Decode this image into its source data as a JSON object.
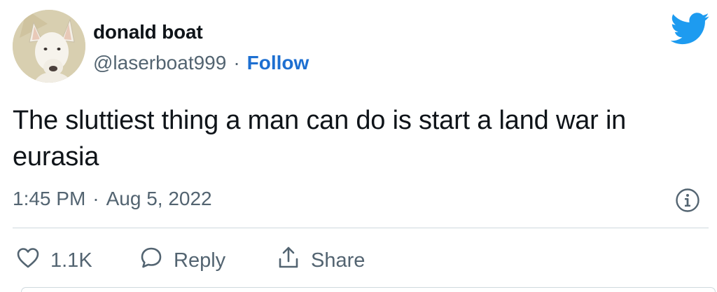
{
  "author": {
    "display_name": "donald boat",
    "handle": "@laserboat999",
    "separator": "·",
    "follow_label": "Follow",
    "avatar_icon": "dog-avatar"
  },
  "brand": {
    "icon": "twitter-bird-icon",
    "color": "#1d9bf0"
  },
  "tweet": {
    "text": "The sluttiest thing a man can do is start a land war in eurasia"
  },
  "meta": {
    "time": "1:45 PM",
    "separator": "·",
    "date": "Aug 5, 2022",
    "info_icon": "info-icon"
  },
  "actions": {
    "like_count": "1.1K",
    "reply_label": "Reply",
    "share_label": "Share"
  }
}
